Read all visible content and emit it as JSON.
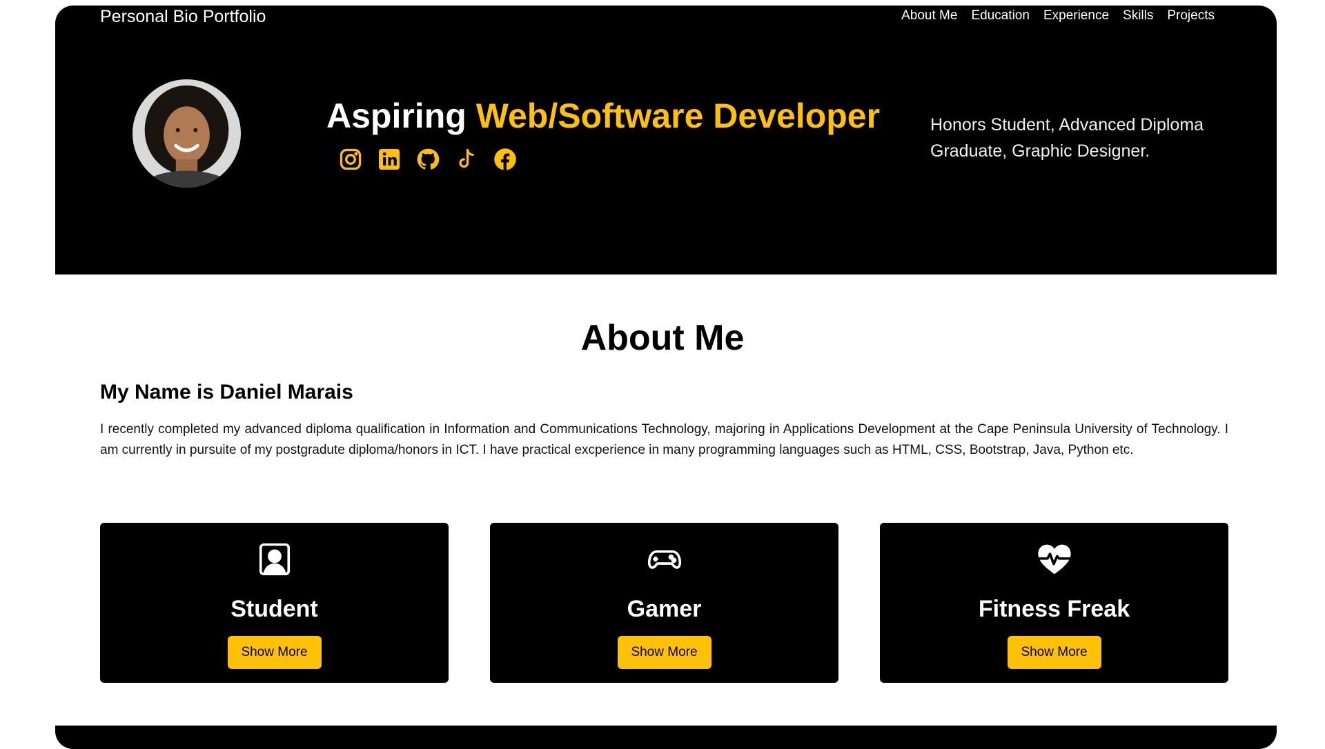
{
  "header": {
    "brand": "Personal Bio Portfolio",
    "nav": [
      "About Me",
      "Education",
      "Experience",
      "Skills",
      "Projects"
    ]
  },
  "hero": {
    "headline_prefix": "Aspiring ",
    "headline_accent": "Web/Software Developer",
    "tagline": "Honors Student, Advanced Diploma Graduate, Graphic Designer.",
    "socials": [
      "instagram-icon",
      "linkedin-icon",
      "github-icon",
      "tiktok-icon",
      "facebook-icon"
    ],
    "accent_color": "#ffc107"
  },
  "about": {
    "title": "About Me",
    "name": "My Name is Daniel Marais",
    "text": "I recently completed my advanced diploma qualification in Information and Communications Technology, majoring in Applications Development at the Cape Peninsula University of Technology. I am currently in pursuite of my postgradute diploma/honors in ICT. I have practical excperience in many programming languages such as HTML, CSS, Bootstrap, Java, Python etc."
  },
  "cards": [
    {
      "icon": "person-badge-icon",
      "title": "Student",
      "button": "Show More"
    },
    {
      "icon": "controller-icon",
      "title": "Gamer",
      "button": "Show More"
    },
    {
      "icon": "heart-pulse-icon",
      "title": "Fitness Freak",
      "button": "Show More"
    }
  ]
}
